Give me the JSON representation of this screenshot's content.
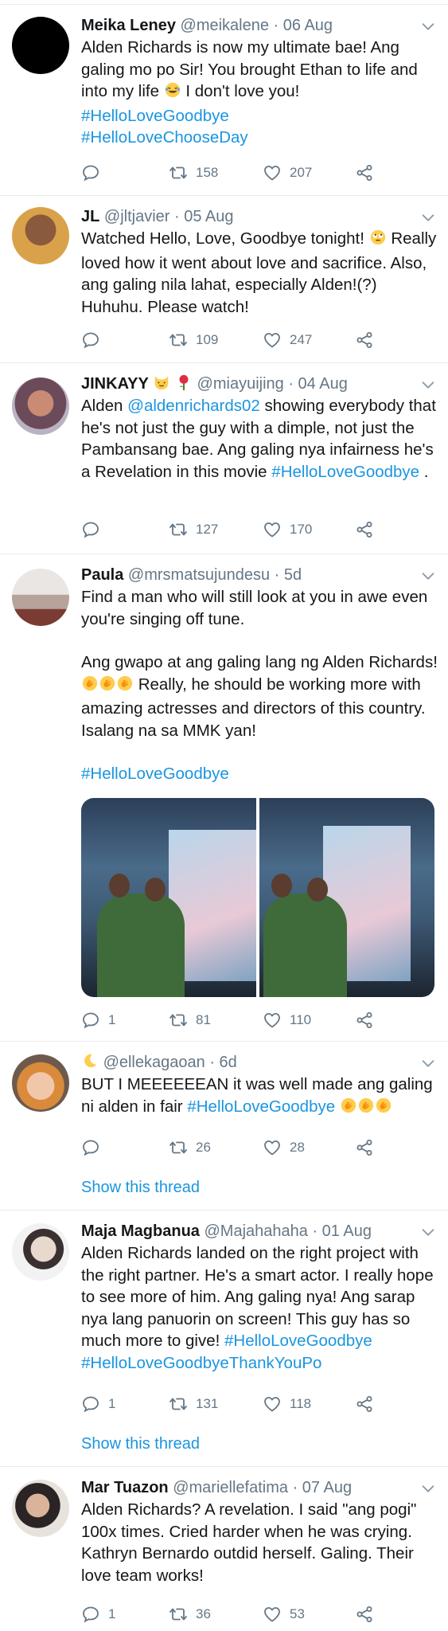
{
  "tweets": [
    {
      "name": "Meika Leney",
      "handle": "@meikalene",
      "date": "· 06 Aug",
      "line1": "Alden Richards is now my ultimate bae! Ang galing mo po Sir! You brought Ethan to life and into my life",
      "line1b": "I don't love you!",
      "tag1": "#HelloLoveGoodbye",
      "tag2": "#HelloLoveChooseDay",
      "retweets": "158",
      "likes": "207"
    },
    {
      "name": "JL",
      "handle": "@jltjavier",
      "date": "· 05 Aug",
      "text": "Watched Hello, Love, Goodbye tonight!",
      "text2": "Really loved how it went about love and sacrifice. Also, ang galing nila lahat, especially Alden!(?) Huhuhu. Please watch!",
      "retweets": "109",
      "likes": "247"
    },
    {
      "name": "JINKAYY",
      "handle": "@miayuijing",
      "date": "· 04 Aug",
      "pre": "Alden ",
      "mention": "@aldenrichards02",
      "text": " showing everybody that he's not just the guy with a dimple, not just the Pambansang bae. Ang galing nya infairness he's a Revelation in this movie ",
      "tag": "#HelloLoveGoodbye",
      "post": " .",
      "retweets": "127",
      "likes": "170"
    },
    {
      "name": "Paula",
      "handle": "@mrsmatsujundesu",
      "date": "· 5d",
      "p1": "Find a man who will still look at you in awe even you're singing off tune.",
      "p2a": "Ang gwapo at ang galing lang ng Alden Richards!",
      "p2b": " Really,  he should be working more with amazing actresses and directors of this country. Isalang na sa MMK yan!",
      "tag": "#HelloLoveGoodbye",
      "replies": "1",
      "retweets": "81",
      "likes": "110"
    },
    {
      "name": "",
      "handle": "@ellekagaoan",
      "date": "· 6d",
      "text": "BUT I MEEEEEEAN it was well made ang galing ni alden in fair ",
      "tag": "#HelloLoveGoodbye",
      "retweets": "26",
      "likes": "28",
      "show_thread": "Show this thread"
    },
    {
      "name": "Maja Magbanua",
      "handle": "@Majahahaha",
      "date": "· 01 Aug",
      "text": "Alden Richards landed on the right project with the right partner. He's a smart actor. I really hope to see more of him. Ang galing nya! Ang sarap nya lang panuorin on screen! This guy has so much more to give! ",
      "tag1": "#HelloLoveGoodbye",
      "tag2": "#HelloLoveGoodbyeThankYouPo",
      "replies": "1",
      "retweets": "131",
      "likes": "118",
      "show_thread": "Show this thread"
    },
    {
      "name": "Mar Tuazon",
      "handle": "@mariellefatima",
      "date": "· 07 Aug",
      "text": "Alden Richards? A revelation. I said \"ang pogi\" 100x times. Cried harder when he was crying. Kathryn Bernardo outdid herself. Galing. Their love team works!",
      "replies": "1",
      "retweets": "36",
      "likes": "53"
    }
  ],
  "icons": {
    "reply": "reply-icon",
    "retweet": "retweet-icon",
    "like": "heart-icon",
    "share": "share-icon",
    "menu": "chevron-down-icon"
  },
  "colors": {
    "link": "#1b95e0",
    "muted": "#657786",
    "text": "#14171a",
    "divider": "#e6ecf0"
  }
}
